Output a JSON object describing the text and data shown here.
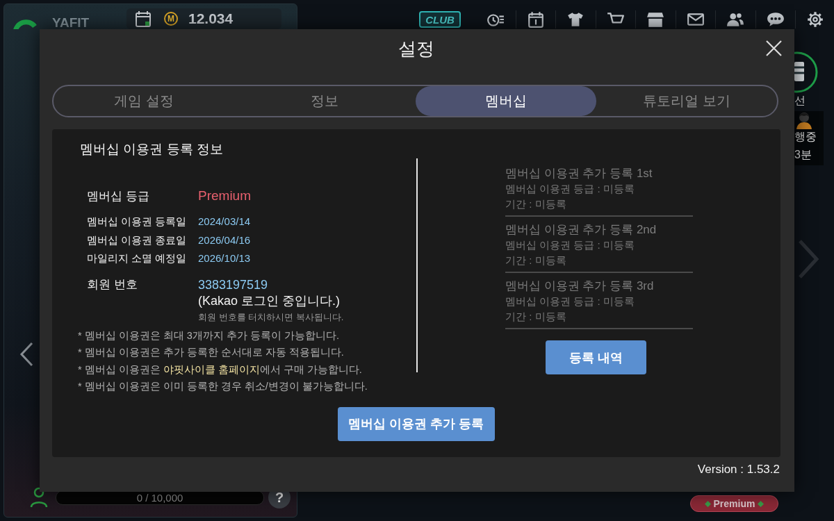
{
  "background": {
    "brand": "YAFIT",
    "coin_symbol": "M",
    "points": "12.034",
    "club_badge": "CLUB",
    "ring_label": "선",
    "status_lines": [
      "행중",
      "3분"
    ],
    "experience": {
      "text": "0 / 10,000",
      "level": 0
    },
    "help_button": "?",
    "membership_badge": "Premium"
  },
  "dialog": {
    "title": "설정",
    "tabs": [
      {
        "label": "게임 설정",
        "selected": false
      },
      {
        "label": "정보",
        "selected": false
      },
      {
        "label": "멤버십",
        "selected": true
      },
      {
        "label": "튜토리얼 보기",
        "selected": false
      }
    ],
    "membership": {
      "heading": "멤버십 이용권 등록 정보",
      "grade": {
        "label": "멤버십 등급",
        "value": "Premium"
      },
      "dates": [
        {
          "label": "멤버십 이용권 등록일",
          "value": "2024/03/14"
        },
        {
          "label": "멤버십 이용권 종료일",
          "value": "2026/04/16"
        },
        {
          "label": "마일리지 소멸 예정일",
          "value": "2026/10/13"
        }
      ],
      "member_number": {
        "label": "회원 번호",
        "value": "3383197519",
        "login": "(Kakao 로그인 중입니다.)",
        "hint": "회원 번호를 터치하시면 복사됩니다."
      },
      "notes": [
        {
          "text": "* 멤버십 이용권은 최대 3개까지 추가 등록이 가능합니다."
        },
        {
          "text": "* 멤버십 이용권은 추가 등록한 순서대로 자동 적용됩니다."
        },
        {
          "text": "* 멤버십 이용권은 ",
          "link": "야핏사이클 홈페이지",
          "after": "에서 구매 가능합니다."
        },
        {
          "text": "* 멤버십 이용권은 이미 등록한 경우 취소/변경이 불가능합니다."
        }
      ],
      "slots": [
        {
          "title": "멤버십 이용권 추가 등록 1st",
          "lines": [
            "멤버십 이용권 등급 : 미등록",
            "기간 : 미등록"
          ]
        },
        {
          "title": "멤버십 이용권 추가 등록 2nd",
          "lines": [
            "멤버십 이용권 등급 : 미등록",
            "기간 : 미등록"
          ]
        },
        {
          "title": "멤버십 이용권 추가 등록 3rd",
          "lines": [
            "멤버십 이용권 등급 : 미등록",
            "기간 : 미등록"
          ]
        }
      ],
      "history_button": "등록 내역",
      "add_button": "멤버십 이용권 추가 등록"
    },
    "version": "Version : 1.53.2"
  }
}
